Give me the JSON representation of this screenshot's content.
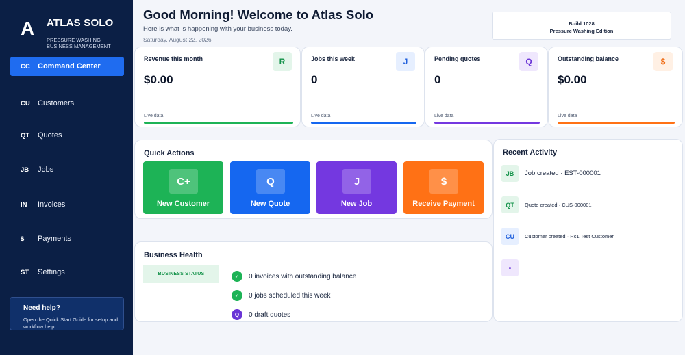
{
  "sidebar": {
    "logo_letter": "A",
    "brand_name": "ATLAS SOLO",
    "brand_tagline": "PRESSURE WASHING BUSINESS MANAGEMENT",
    "items": [
      {
        "code": "CC",
        "label": "Command Center"
      },
      {
        "code": "CU",
        "label": "Customers"
      },
      {
        "code": "QT",
        "label": "Quotes"
      },
      {
        "code": "JB",
        "label": "Jobs"
      },
      {
        "code": "IN",
        "label": "Invoices"
      },
      {
        "code": "$",
        "label": "Payments"
      },
      {
        "code": "ST",
        "label": "Settings"
      }
    ],
    "help": {
      "title": "Need help?",
      "text": "Open the Quick Start Guide for setup and workflow help."
    }
  },
  "header": {
    "greeting": "Good Morning! Welcome to Atlas Solo",
    "subtext": "Here is what is happening with your business today.",
    "date": "Saturday, August 22, 2026",
    "build": "Build 1028",
    "edition": "Pressure Washing Edition"
  },
  "kpis": [
    {
      "label": "Revenue this month",
      "badge": "R",
      "value": "$0.00",
      "foot": "Live data"
    },
    {
      "label": "Jobs this week",
      "badge": "J",
      "value": "0",
      "foot": "Live data"
    },
    {
      "label": "Pending quotes",
      "badge": "Q",
      "value": "0",
      "foot": "Live data"
    },
    {
      "label": "Outstanding balance",
      "badge": "$",
      "value": "$0.00",
      "foot": "Live data"
    }
  ],
  "quick_actions": {
    "title": "Quick Actions",
    "buttons": [
      {
        "icon": "C+",
        "label": "New Customer"
      },
      {
        "icon": "Q",
        "label": "New Quote"
      },
      {
        "icon": "J",
        "label": "New Job"
      },
      {
        "icon": "$",
        "label": "Receive Payment"
      }
    ]
  },
  "business_health": {
    "title": "Business Health",
    "status": "BUSINESS STATUS",
    "items": [
      {
        "icon": "✓",
        "text": "0 invoices with outstanding balance"
      },
      {
        "icon": "✓",
        "text": "0 jobs scheduled this week"
      },
      {
        "icon": "Q",
        "text": "0 draft quotes"
      }
    ]
  },
  "recent_activity": {
    "title": "Recent Activity",
    "items": [
      {
        "code": "JB",
        "text": "Job created · EST-000001"
      },
      {
        "code": "QT",
        "text": "Quote created · CUS-000001"
      },
      {
        "code": "CU",
        "text": "Customer created · Rc1 Test Customer"
      },
      {
        "code": "•",
        "text": ""
      }
    ]
  },
  "colors": {
    "sidebar_bg": "#0b1f45",
    "accent_blue": "#1f6cf0",
    "green": "#1db356",
    "blue": "#1567f0",
    "purple": "#7438e0",
    "orange": "#ff7115"
  }
}
